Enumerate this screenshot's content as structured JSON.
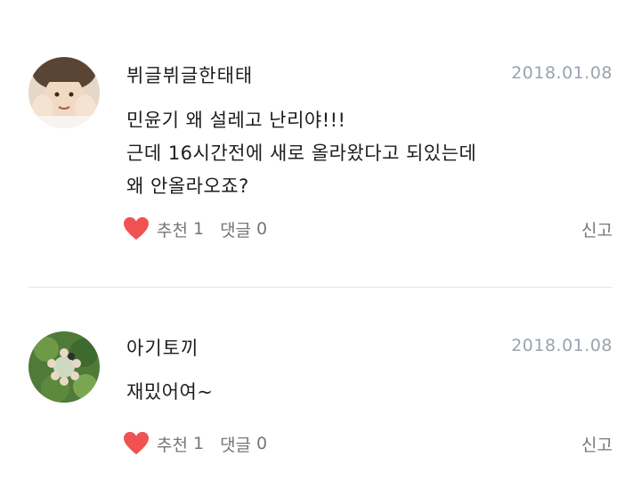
{
  "comments": [
    {
      "username": "뷔글뷔글한태태",
      "date": "2018.01.08",
      "body_lines": [
        "민윤기 왜 설레고 난리야!!!",
        "근데 16시간전에 새로 올라왔다고 되있는데",
        "왜 안올라오죠?"
      ],
      "like_label": "추천",
      "like_count": "1",
      "reply_label": "댓글",
      "reply_count": "0",
      "report_label": "신고"
    },
    {
      "username": "아기토끼",
      "date": "2018.01.08",
      "body_lines": [
        "재밌어여~"
      ],
      "like_label": "추천",
      "like_count": "1",
      "reply_label": "댓글",
      "reply_count": "0",
      "report_label": "신고"
    }
  ],
  "colors": {
    "heart": "#f05252",
    "date": "#9aa3ac",
    "divider": "#e3e6ea"
  },
  "icons": {
    "like": "heart-icon"
  }
}
